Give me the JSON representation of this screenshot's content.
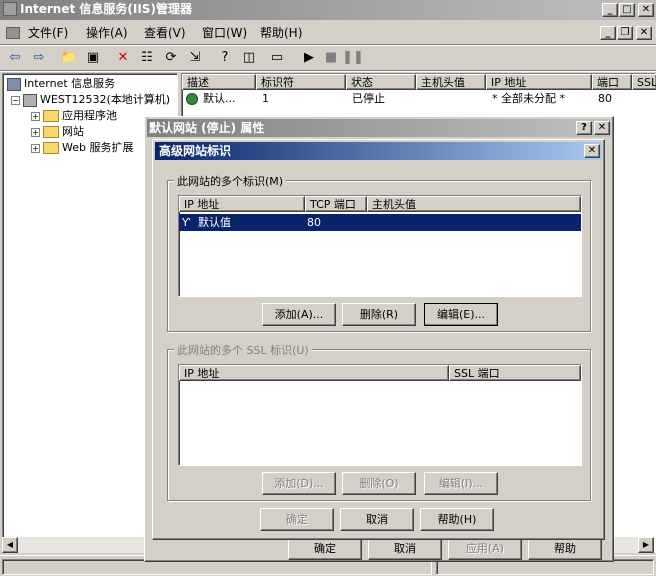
{
  "app": {
    "title": "Internet 信息服务(IIS)管理器"
  },
  "menu": [
    "文件(F)",
    "操作(A)",
    "查看(V)",
    "窗口(W)",
    "帮助(H)"
  ],
  "tree": {
    "root": "Internet 信息服务",
    "server": "WEST12532(本地计算机)",
    "children": [
      "应用程序池",
      "网站",
      "Web 服务扩展"
    ]
  },
  "list": {
    "columns": [
      "描述",
      "标识符",
      "状态",
      "主机头值",
      "IP 地址",
      "端口",
      "SSL"
    ],
    "rows": [
      {
        "desc": "默认...",
        "id": "1",
        "status": "已停止",
        "host": "",
        "ip": "* 全部未分配 *",
        "port": "80"
      }
    ]
  },
  "props_dialog": {
    "title": "默认网站 (停止) 属性",
    "help_btn": "?",
    "buttons": {
      "ok": "确定",
      "cancel": "取消",
      "apply": "应用(A)",
      "help": "帮助"
    }
  },
  "adv_dialog": {
    "title": "高级网站标识",
    "group1": {
      "label": "此网站的多个标识(M)",
      "columns": [
        "IP 地址",
        "TCP 端口",
        "主机头值"
      ],
      "rows": [
        {
          "ip": "默认值",
          "port": "80",
          "host": ""
        }
      ],
      "buttons": {
        "add": "添加(A)...",
        "remove": "删除(R)",
        "edit": "编辑(E)..."
      }
    },
    "group2": {
      "label": "此网站的多个 SSL 标识(U)",
      "columns": [
        "IP 地址",
        "SSL 端口"
      ],
      "buttons": {
        "add": "添加(D)...",
        "remove": "删除(O)",
        "edit": "编辑(I)..."
      }
    },
    "buttons": {
      "ok": "确定",
      "cancel": "取消",
      "help": "帮助(H)"
    }
  }
}
